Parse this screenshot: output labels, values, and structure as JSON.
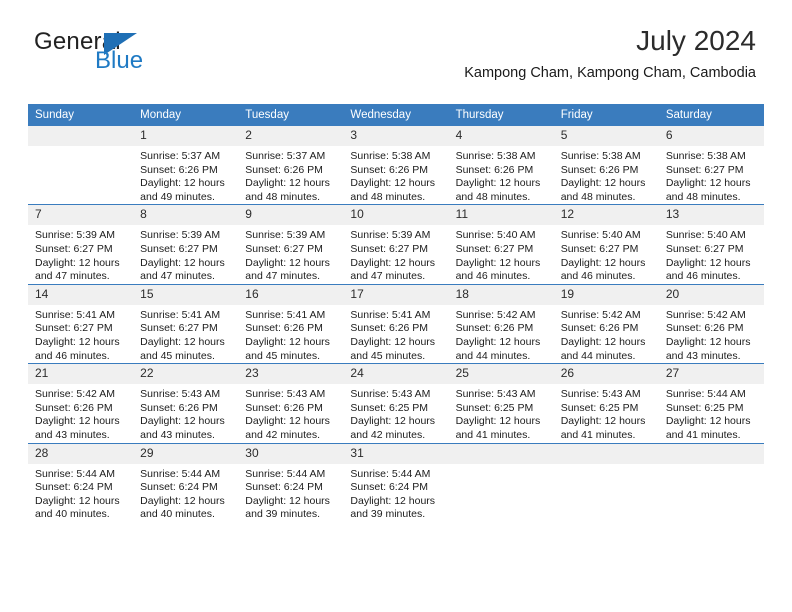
{
  "brand": {
    "name_part1": "General",
    "name_part2": "Blue",
    "logo_icon": "triangle-flag-icon",
    "color_primary": "#1f7ac4",
    "color_text": "#222222"
  },
  "header": {
    "title": "July 2024",
    "subtitle": "Kampong Cham, Kampong Cham, Cambodia"
  },
  "theme": {
    "header_row_bg": "#3a7cbe",
    "daynum_bg": "#f0f0f0",
    "grid_line": "#3a7cbe"
  },
  "weekdays": [
    "Sunday",
    "Monday",
    "Tuesday",
    "Wednesday",
    "Thursday",
    "Friday",
    "Saturday"
  ],
  "weeks": [
    [
      {
        "day": "",
        "empty": true,
        "sunrise": "",
        "sunset": "",
        "daylight_line1": "",
        "daylight_line2": ""
      },
      {
        "day": "1",
        "sunrise": "Sunrise: 5:37 AM",
        "sunset": "Sunset: 6:26 PM",
        "daylight_line1": "Daylight: 12 hours",
        "daylight_line2": "and 49 minutes."
      },
      {
        "day": "2",
        "sunrise": "Sunrise: 5:37 AM",
        "sunset": "Sunset: 6:26 PM",
        "daylight_line1": "Daylight: 12 hours",
        "daylight_line2": "and 48 minutes."
      },
      {
        "day": "3",
        "sunrise": "Sunrise: 5:38 AM",
        "sunset": "Sunset: 6:26 PM",
        "daylight_line1": "Daylight: 12 hours",
        "daylight_line2": "and 48 minutes."
      },
      {
        "day": "4",
        "sunrise": "Sunrise: 5:38 AM",
        "sunset": "Sunset: 6:26 PM",
        "daylight_line1": "Daylight: 12 hours",
        "daylight_line2": "and 48 minutes."
      },
      {
        "day": "5",
        "sunrise": "Sunrise: 5:38 AM",
        "sunset": "Sunset: 6:26 PM",
        "daylight_line1": "Daylight: 12 hours",
        "daylight_line2": "and 48 minutes."
      },
      {
        "day": "6",
        "sunrise": "Sunrise: 5:38 AM",
        "sunset": "Sunset: 6:27 PM",
        "daylight_line1": "Daylight: 12 hours",
        "daylight_line2": "and 48 minutes."
      }
    ],
    [
      {
        "day": "7",
        "sunrise": "Sunrise: 5:39 AM",
        "sunset": "Sunset: 6:27 PM",
        "daylight_line1": "Daylight: 12 hours",
        "daylight_line2": "and 47 minutes."
      },
      {
        "day": "8",
        "sunrise": "Sunrise: 5:39 AM",
        "sunset": "Sunset: 6:27 PM",
        "daylight_line1": "Daylight: 12 hours",
        "daylight_line2": "and 47 minutes."
      },
      {
        "day": "9",
        "sunrise": "Sunrise: 5:39 AM",
        "sunset": "Sunset: 6:27 PM",
        "daylight_line1": "Daylight: 12 hours",
        "daylight_line2": "and 47 minutes."
      },
      {
        "day": "10",
        "sunrise": "Sunrise: 5:39 AM",
        "sunset": "Sunset: 6:27 PM",
        "daylight_line1": "Daylight: 12 hours",
        "daylight_line2": "and 47 minutes."
      },
      {
        "day": "11",
        "sunrise": "Sunrise: 5:40 AM",
        "sunset": "Sunset: 6:27 PM",
        "daylight_line1": "Daylight: 12 hours",
        "daylight_line2": "and 46 minutes."
      },
      {
        "day": "12",
        "sunrise": "Sunrise: 5:40 AM",
        "sunset": "Sunset: 6:27 PM",
        "daylight_line1": "Daylight: 12 hours",
        "daylight_line2": "and 46 minutes."
      },
      {
        "day": "13",
        "sunrise": "Sunrise: 5:40 AM",
        "sunset": "Sunset: 6:27 PM",
        "daylight_line1": "Daylight: 12 hours",
        "daylight_line2": "and 46 minutes."
      }
    ],
    [
      {
        "day": "14",
        "sunrise": "Sunrise: 5:41 AM",
        "sunset": "Sunset: 6:27 PM",
        "daylight_line1": "Daylight: 12 hours",
        "daylight_line2": "and 46 minutes."
      },
      {
        "day": "15",
        "sunrise": "Sunrise: 5:41 AM",
        "sunset": "Sunset: 6:27 PM",
        "daylight_line1": "Daylight: 12 hours",
        "daylight_line2": "and 45 minutes."
      },
      {
        "day": "16",
        "sunrise": "Sunrise: 5:41 AM",
        "sunset": "Sunset: 6:26 PM",
        "daylight_line1": "Daylight: 12 hours",
        "daylight_line2": "and 45 minutes."
      },
      {
        "day": "17",
        "sunrise": "Sunrise: 5:41 AM",
        "sunset": "Sunset: 6:26 PM",
        "daylight_line1": "Daylight: 12 hours",
        "daylight_line2": "and 45 minutes."
      },
      {
        "day": "18",
        "sunrise": "Sunrise: 5:42 AM",
        "sunset": "Sunset: 6:26 PM",
        "daylight_line1": "Daylight: 12 hours",
        "daylight_line2": "and 44 minutes."
      },
      {
        "day": "19",
        "sunrise": "Sunrise: 5:42 AM",
        "sunset": "Sunset: 6:26 PM",
        "daylight_line1": "Daylight: 12 hours",
        "daylight_line2": "and 44 minutes."
      },
      {
        "day": "20",
        "sunrise": "Sunrise: 5:42 AM",
        "sunset": "Sunset: 6:26 PM",
        "daylight_line1": "Daylight: 12 hours",
        "daylight_line2": "and 43 minutes."
      }
    ],
    [
      {
        "day": "21",
        "sunrise": "Sunrise: 5:42 AM",
        "sunset": "Sunset: 6:26 PM",
        "daylight_line1": "Daylight: 12 hours",
        "daylight_line2": "and 43 minutes."
      },
      {
        "day": "22",
        "sunrise": "Sunrise: 5:43 AM",
        "sunset": "Sunset: 6:26 PM",
        "daylight_line1": "Daylight: 12 hours",
        "daylight_line2": "and 43 minutes."
      },
      {
        "day": "23",
        "sunrise": "Sunrise: 5:43 AM",
        "sunset": "Sunset: 6:26 PM",
        "daylight_line1": "Daylight: 12 hours",
        "daylight_line2": "and 42 minutes."
      },
      {
        "day": "24",
        "sunrise": "Sunrise: 5:43 AM",
        "sunset": "Sunset: 6:25 PM",
        "daylight_line1": "Daylight: 12 hours",
        "daylight_line2": "and 42 minutes."
      },
      {
        "day": "25",
        "sunrise": "Sunrise: 5:43 AM",
        "sunset": "Sunset: 6:25 PM",
        "daylight_line1": "Daylight: 12 hours",
        "daylight_line2": "and 41 minutes."
      },
      {
        "day": "26",
        "sunrise": "Sunrise: 5:43 AM",
        "sunset": "Sunset: 6:25 PM",
        "daylight_line1": "Daylight: 12 hours",
        "daylight_line2": "and 41 minutes."
      },
      {
        "day": "27",
        "sunrise": "Sunrise: 5:44 AM",
        "sunset": "Sunset: 6:25 PM",
        "daylight_line1": "Daylight: 12 hours",
        "daylight_line2": "and 41 minutes."
      }
    ],
    [
      {
        "day": "28",
        "sunrise": "Sunrise: 5:44 AM",
        "sunset": "Sunset: 6:24 PM",
        "daylight_line1": "Daylight: 12 hours",
        "daylight_line2": "and 40 minutes."
      },
      {
        "day": "29",
        "sunrise": "Sunrise: 5:44 AM",
        "sunset": "Sunset: 6:24 PM",
        "daylight_line1": "Daylight: 12 hours",
        "daylight_line2": "and 40 minutes."
      },
      {
        "day": "30",
        "sunrise": "Sunrise: 5:44 AM",
        "sunset": "Sunset: 6:24 PM",
        "daylight_line1": "Daylight: 12 hours",
        "daylight_line2": "and 39 minutes."
      },
      {
        "day": "31",
        "sunrise": "Sunrise: 5:44 AM",
        "sunset": "Sunset: 6:24 PM",
        "daylight_line1": "Daylight: 12 hours",
        "daylight_line2": "and 39 minutes."
      },
      {
        "day": "",
        "empty": true,
        "sunrise": "",
        "sunset": "",
        "daylight_line1": "",
        "daylight_line2": ""
      },
      {
        "day": "",
        "empty": true,
        "sunrise": "",
        "sunset": "",
        "daylight_line1": "",
        "daylight_line2": ""
      },
      {
        "day": "",
        "empty": true,
        "sunrise": "",
        "sunset": "",
        "daylight_line1": "",
        "daylight_line2": ""
      }
    ]
  ]
}
